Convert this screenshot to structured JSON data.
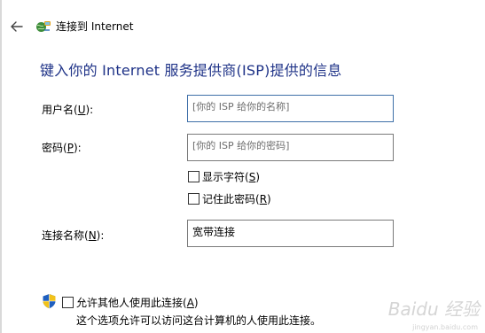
{
  "window": {
    "title": "连接到 Internet",
    "back_icon": "back-arrow-icon",
    "network_icon": "network-globe-icon"
  },
  "heading": "键入你的 Internet 服务提供商(ISP)提供的信息",
  "form": {
    "username": {
      "label_prefix": "用户名(",
      "label_key": "U",
      "label_suffix": "):",
      "placeholder": "[你的 ISP 给你的名称]"
    },
    "password": {
      "label_prefix": "密码(",
      "label_key": "P",
      "label_suffix": "):",
      "placeholder": "[你的 ISP 给你的密码]"
    },
    "show_chars": {
      "label_prefix": "显示字符(",
      "label_key": "S",
      "label_suffix": ")",
      "checked": false
    },
    "remember_password": {
      "label_prefix": "记住此密码(",
      "label_key": "R",
      "label_suffix": ")",
      "checked": false
    },
    "connection_name": {
      "label_prefix": "连接名称(",
      "label_key": "N",
      "label_suffix": "):",
      "value": "宽带连接"
    }
  },
  "allow_others": {
    "shield_icon": "uac-shield-icon",
    "label_prefix": "允许其他人使用此连接(",
    "label_key": "A",
    "label_suffix": ")",
    "checked": false,
    "description": "这个选项允许可以访问这台计算机的人使用此连接。"
  },
  "watermark": {
    "text": "Baidu 经验",
    "subtext": "jingyan.baidu.com"
  },
  "colors": {
    "heading": "#1e3287",
    "focus_border": "#3e6fa8"
  }
}
